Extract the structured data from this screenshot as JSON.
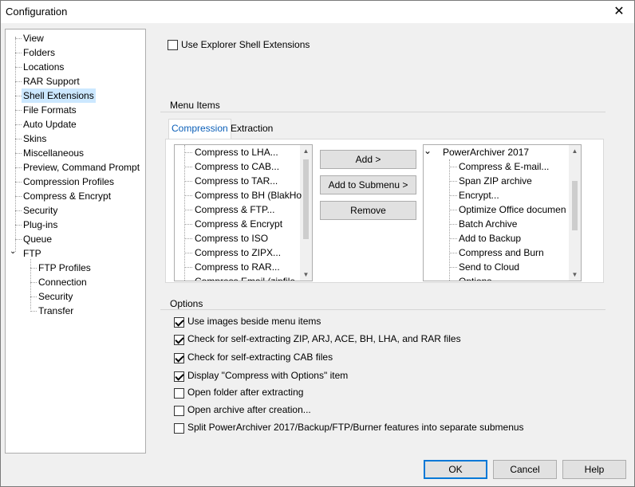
{
  "window": {
    "title": "Configuration"
  },
  "tree": {
    "items": [
      {
        "label": "View"
      },
      {
        "label": "Folders"
      },
      {
        "label": "Locations"
      },
      {
        "label": "RAR Support"
      },
      {
        "label": "Shell Extensions",
        "selected": true
      },
      {
        "label": "File Formats"
      },
      {
        "label": "Auto Update"
      },
      {
        "label": "Skins"
      },
      {
        "label": "Miscellaneous"
      },
      {
        "label": "Preview, Command Prompt"
      },
      {
        "label": "Compression Profiles"
      },
      {
        "label": "Compress & Encrypt"
      },
      {
        "label": "Security"
      },
      {
        "label": "Plug-ins"
      },
      {
        "label": "Queue"
      },
      {
        "label": "FTP",
        "expanded": true
      },
      {
        "label": "FTP Profiles"
      },
      {
        "label": "Connection"
      },
      {
        "label": "Security"
      },
      {
        "label": "Transfer"
      }
    ]
  },
  "shell": {
    "use_explorer_label": "Use Explorer Shell Extensions",
    "use_explorer_checked": false
  },
  "menu_items": {
    "group_title": "Menu Items",
    "tabs": [
      {
        "label": "Compression",
        "active": true
      },
      {
        "label": "Extraction"
      }
    ],
    "available": [
      "Compress to LHA...",
      "Compress to CAB...",
      "Compress to TAR...",
      "Compress to BH (BlakHo",
      "Compress & FTP...",
      "Compress & Encrypt",
      "Compress to ISO",
      "Compress to ZIPX...",
      "Compress to RAR...",
      "Compress Email (zipfile"
    ],
    "add_label": "Add >",
    "add_submenu_label": "Add to Submenu >",
    "remove_label": "Remove",
    "root_label": "PowerArchiver 2017",
    "selected": [
      "Compress & E-mail...",
      "Span ZIP archive",
      "Encrypt...",
      "Optimize Office documen",
      "Batch Archive",
      "Add to Backup",
      "Compress and Burn",
      "Send to Cloud",
      "Options"
    ]
  },
  "options": {
    "group_title": "Options",
    "items": [
      {
        "label": "Use images beside menu items",
        "checked": true
      },
      {
        "label": "Check for self-extracting ZIP, ARJ, ACE, BH, LHA, and RAR files",
        "checked": true
      },
      {
        "label": "Check for self-extracting CAB files",
        "checked": true
      },
      {
        "label": "Display \"Compress with Options\" item",
        "checked": true
      },
      {
        "label": "Open folder after extracting",
        "checked": false
      },
      {
        "label": "Open archive after creation...",
        "checked": false
      },
      {
        "label": "Split PowerArchiver 2017/Backup/FTP/Burner features into separate submenus",
        "checked": false
      }
    ]
  },
  "footer": {
    "ok_label": "OK",
    "cancel_label": "Cancel",
    "help_label": "Help"
  }
}
